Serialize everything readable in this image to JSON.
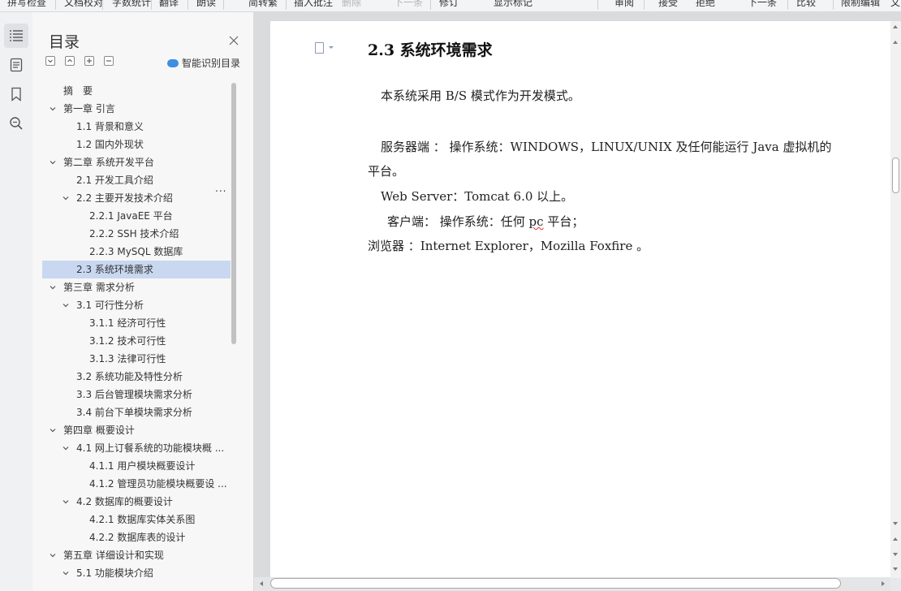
{
  "toolbar": {
    "items": [
      {
        "label": "拼写检查",
        "disabled": false
      },
      {
        "label": "文档校对",
        "disabled": false
      },
      {
        "label": "字数统计",
        "disabled": false
      },
      {
        "label": "翻译",
        "disabled": false
      },
      {
        "label": "朗读",
        "disabled": false
      },
      {
        "label": "简转繁",
        "disabled": false
      },
      {
        "label": "插入批注",
        "disabled": false
      },
      {
        "label": "删除",
        "disabled": true
      },
      {
        "label": "下一条",
        "disabled": true
      },
      {
        "label": "修订",
        "disabled": false
      },
      {
        "label": "显示标记",
        "disabled": false
      },
      {
        "label": "审阅",
        "disabled": false
      },
      {
        "label": "接受",
        "disabled": false
      },
      {
        "label": "拒绝",
        "disabled": false
      },
      {
        "label": "下一条",
        "disabled": false
      },
      {
        "label": "比较",
        "disabled": false
      },
      {
        "label": "限制编辑",
        "disabled": false
      },
      {
        "label": "文",
        "disabled": false
      }
    ]
  },
  "nav": {
    "title": "目录",
    "smart_label": "智能识别目录",
    "more": "...",
    "items": [
      {
        "label": "摘　要",
        "level": 1,
        "caret": "none"
      },
      {
        "label": "第一章  引言",
        "level": 1,
        "caret": "open"
      },
      {
        "label": "1.1 背景和意义",
        "level": 2,
        "caret": "none"
      },
      {
        "label": "1.2 国内外现状",
        "level": 2,
        "caret": "none"
      },
      {
        "label": "第二章  系统开发平台",
        "level": 1,
        "caret": "open"
      },
      {
        "label": "2.1 开发工具介绍",
        "level": 2,
        "caret": "none"
      },
      {
        "label": "2.2 主要开发技术介绍",
        "level": 2,
        "caret": "open"
      },
      {
        "label": "2.2.1 JavaEE 平台",
        "level": 3,
        "caret": "none"
      },
      {
        "label": "2.2.2 SSH 技术介绍",
        "level": 3,
        "caret": "none"
      },
      {
        "label": "2.2.3 MySQL 数据库",
        "level": 3,
        "caret": "none"
      },
      {
        "label": "2.3 系统环境需求",
        "level": 2,
        "caret": "none",
        "selected": true
      },
      {
        "label": "第三章  需求分析",
        "level": 1,
        "caret": "open"
      },
      {
        "label": "3.1 可行性分析",
        "level": 2,
        "caret": "open"
      },
      {
        "label": "3.1.1 经济可行性",
        "level": 3,
        "caret": "none"
      },
      {
        "label": "3.1.2 技术可行性",
        "level": 3,
        "caret": "none"
      },
      {
        "label": "3.1.3 法律可行性",
        "level": 3,
        "caret": "none"
      },
      {
        "label": "3.2 系统功能及特性分析",
        "level": 2,
        "caret": "none"
      },
      {
        "label": "3.3 后台管理模块需求分析",
        "level": 2,
        "caret": "none"
      },
      {
        "label": "3.4 前台下单模块需求分析",
        "level": 2,
        "caret": "none"
      },
      {
        "label": "第四章  概要设计",
        "level": 1,
        "caret": "open"
      },
      {
        "label": "4.1 网上订餐系统的功能模块概 ...",
        "level": 2,
        "caret": "open"
      },
      {
        "label": "4.1.1 用户模块概要设计",
        "level": 3,
        "caret": "none"
      },
      {
        "label": "4.1.2 管理员功能模块概要设 ...",
        "level": 3,
        "caret": "none"
      },
      {
        "label": "4.2 数据库的概要设计",
        "level": 2,
        "caret": "open"
      },
      {
        "label": "4.2.1 数据库实体关系图",
        "level": 3,
        "caret": "none"
      },
      {
        "label": "4.2.2 数据库表的设计",
        "level": 3,
        "caret": "none"
      },
      {
        "label": "第五章  详细设计和实现",
        "level": 1,
        "caret": "open"
      },
      {
        "label": "5.1 功能模块介绍",
        "level": 2,
        "caret": "open"
      }
    ]
  },
  "doc": {
    "heading": "2.3 系统环境需求",
    "p1": "本系统采用 B/S 模式作为开发模式。",
    "p2a": "服务器端 ：  操作系统：WINDOWS，LINUX/UNIX 及任何能运行 Java 虚拟机的",
    "p2b": "平台。",
    "p3": "Web Server：Tomcat 6.0 以上。",
    "p4_pre": "客户端：  操作系统：任何 ",
    "p4_wavy": "pc",
    "p4_post": " 平台；",
    "p5": "浏览器 ：Internet Explorer，Mozilla Foxfire 。"
  }
}
